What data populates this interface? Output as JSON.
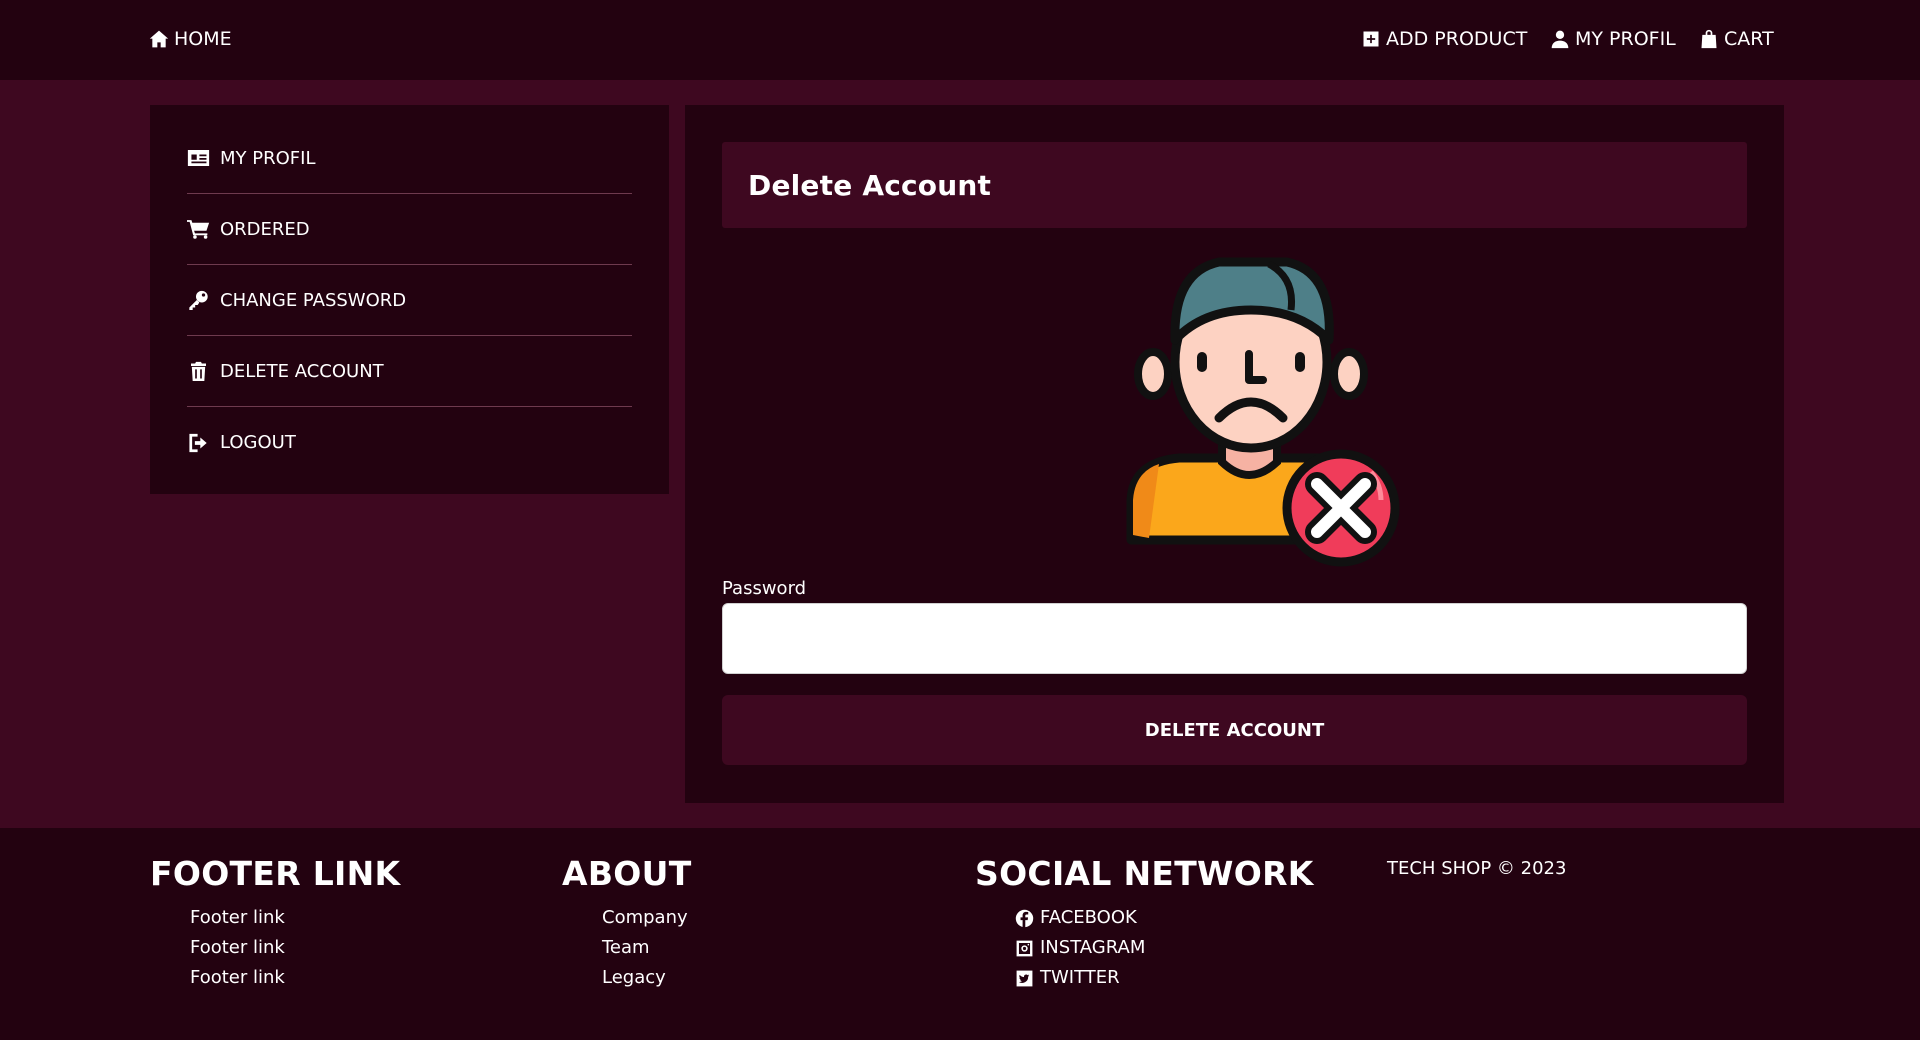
{
  "nav": {
    "home": "HOME",
    "add_product": "ADD PRODUCT",
    "my_profil": "MY PROFIL",
    "cart": "CART"
  },
  "sidebar": {
    "items": [
      {
        "label": "MY PROFIL",
        "icon": "id-card-icon"
      },
      {
        "label": "ORDERED",
        "icon": "cart-icon"
      },
      {
        "label": "CHANGE PASSWORD",
        "icon": "key-icon"
      },
      {
        "label": "DELETE ACCOUNT",
        "icon": "trash-icon"
      },
      {
        "label": "LOGOUT",
        "icon": "logout-icon"
      }
    ]
  },
  "main": {
    "title": "Delete Account",
    "password_label": "Password",
    "password_value": "",
    "delete_button": "DELETE ACCOUNT"
  },
  "footer": {
    "col1": {
      "title": "FOOTER LINK",
      "links": [
        "Footer link",
        "Footer link",
        "Footer link"
      ]
    },
    "col2": {
      "title": "ABOUT",
      "links": [
        "Company",
        "Team",
        "Legacy"
      ]
    },
    "col3": {
      "title": "SOCIAL NETWORK",
      "links": [
        "FACEBOOK",
        "INSTAGRAM",
        "TWITTER"
      ]
    },
    "copyright": "TECH SHOP © 2023"
  },
  "colors": {
    "background": "#3e0820",
    "panel": "#230210",
    "accent_red": "#f03c5a",
    "shirt_orange": "#fba71b"
  }
}
